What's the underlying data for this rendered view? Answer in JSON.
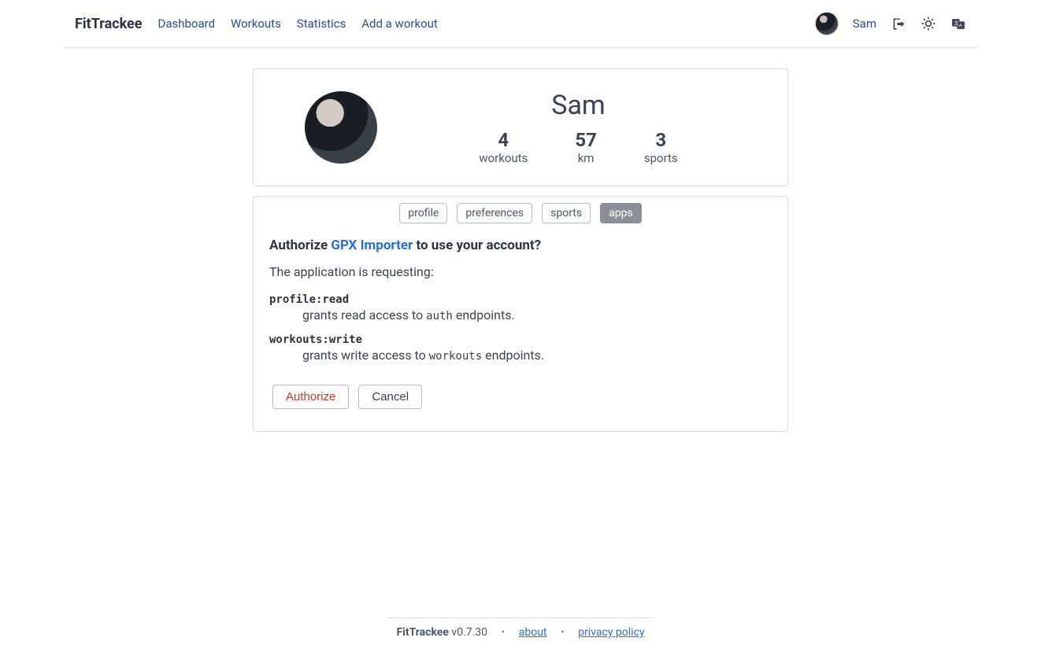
{
  "header": {
    "brand": "FitTrackee",
    "nav": {
      "dashboard": "Dashboard",
      "workouts": "Workouts",
      "statistics": "Statistics",
      "add_workout": "Add a workout"
    },
    "user_name": "Sam"
  },
  "profile": {
    "name": "Sam",
    "stats": {
      "workouts_value": "4",
      "workouts_label": "workouts",
      "km_value": "57",
      "km_label": "km",
      "sports_value": "3",
      "sports_label": "sports"
    }
  },
  "tabs": {
    "profile": "profile",
    "preferences": "preferences",
    "sports": "sports",
    "apps": "apps"
  },
  "authorize": {
    "prefix": "Authorize ",
    "app_name": "GPX Importer",
    "suffix": " to use your account?",
    "requesting": "The application is requesting:",
    "scopes": [
      {
        "name": "profile:read",
        "desc_before": "grants read access to ",
        "desc_code": "auth",
        "desc_after": " endpoints."
      },
      {
        "name": "workouts:write",
        "desc_before": "grants write access to ",
        "desc_code": "workouts",
        "desc_after": " endpoints."
      }
    ],
    "authorize_btn": "Authorize",
    "cancel_btn": "Cancel"
  },
  "footer": {
    "brand": "FitTrackee",
    "version": " v0.7.30",
    "about": "about",
    "privacy": "privacy policy"
  }
}
